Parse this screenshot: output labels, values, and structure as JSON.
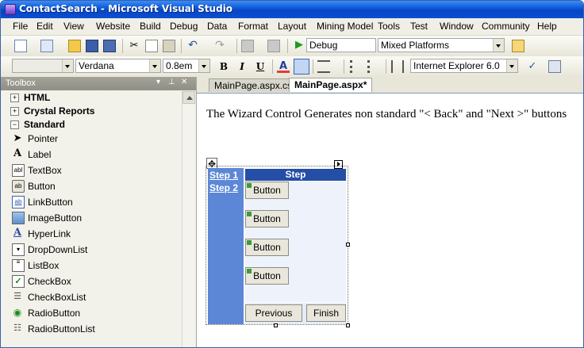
{
  "window": {
    "title": "ContactSearch - Microsoft Visual Studio"
  },
  "menu": [
    "File",
    "Edit",
    "View",
    "Website",
    "Build",
    "Debug",
    "Data",
    "Format",
    "Layout",
    "Mining Model",
    "Tools",
    "Test",
    "Window",
    "Community",
    "Help"
  ],
  "toolbar1": {
    "config": "Debug",
    "platform": "Mixed Platforms"
  },
  "toolbar2": {
    "style_value": "",
    "font": "Verdana",
    "size": "0.8em",
    "bold": "B",
    "italic": "I",
    "underline": "U",
    "browser": "Internet Explorer 6.0"
  },
  "toolbox": {
    "title": "Toolbox",
    "categories": [
      {
        "label": "HTML",
        "sign": "+"
      },
      {
        "label": "Crystal Reports",
        "sign": "+"
      },
      {
        "label": "Standard",
        "sign": "−"
      }
    ],
    "items": [
      "Pointer",
      "Label",
      "TextBox",
      "Button",
      "LinkButton",
      "ImageButton",
      "HyperLink",
      "DropDownList",
      "ListBox",
      "CheckBox",
      "CheckBoxList",
      "RadioButton",
      "RadioButtonList"
    ]
  },
  "tabs": [
    {
      "label": "MainPage.aspx.cs",
      "active": false
    },
    {
      "label": "MainPage.aspx*",
      "active": true
    }
  ],
  "editor": {
    "description": "The Wizard Control Generates non standard \"< Back\" and \"Next >\" buttons",
    "wizard": {
      "header": "Step",
      "steps": [
        "Step 1",
        "Step 2"
      ],
      "buttons": [
        "Button",
        "Button",
        "Button",
        "Button"
      ],
      "previous": "Previous",
      "finish": "Finish"
    }
  },
  "colors": {
    "wizard_sidebar": "#5c87d6",
    "wizard_header": "#254ea6",
    "titlebar": "#0a55d6"
  }
}
